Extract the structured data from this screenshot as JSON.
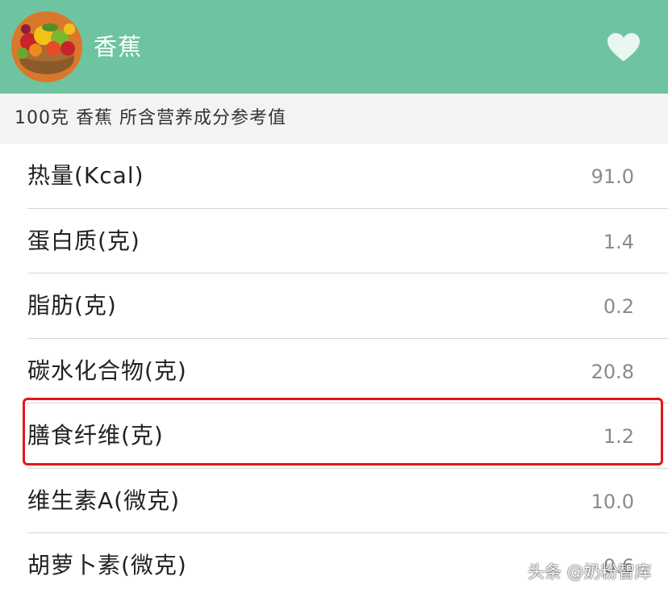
{
  "header": {
    "title": "香蕉",
    "avatar_icon": "fruit-basket-icon",
    "favorite_icon": "heart-icon",
    "bg_color": "#6ec4a0"
  },
  "subtitle": "100克 香蕉 所含营养成分参考值",
  "nutrients": [
    {
      "label": "热量(Kcal)",
      "value": "91.0"
    },
    {
      "label": "蛋白质(克)",
      "value": "1.4"
    },
    {
      "label": "脂肪(克)",
      "value": "0.2"
    },
    {
      "label": "碳水化合物(克)",
      "value": "20.8"
    },
    {
      "label": "膳食纤维(克)",
      "value": "1.2",
      "highlighted": true
    },
    {
      "label": "维生素A(微克)",
      "value": "10.0"
    },
    {
      "label": "胡萝卜素(微克)",
      "value": "0.6"
    }
  ],
  "highlight_color": "#e4161c",
  "watermark": "头条 @奶粉智库"
}
